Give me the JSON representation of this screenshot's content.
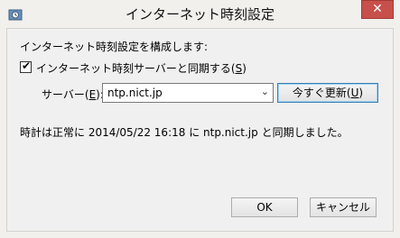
{
  "window": {
    "title": "インターネット時刻設定",
    "close_glyph": "✕"
  },
  "main": {
    "heading": "インターネット時刻設定を構成します:",
    "sync_checkbox": {
      "checked": true,
      "label_prefix": "インターネット時刻サーバーと同期する(",
      "label_mnemonic": "S",
      "label_suffix": ")"
    },
    "server": {
      "label_prefix": "サーバー(",
      "label_mnemonic": "E",
      "label_suffix": "):",
      "value": "ntp.nict.jp"
    },
    "update_button": {
      "label_prefix": "今すぐ更新(",
      "label_mnemonic": "U",
      "label_suffix": ")"
    },
    "status_text": "時計は正常に 2014/05/22 16:18 に ntp.nict.jp と同期しました。"
  },
  "footer": {
    "ok_label": "OK",
    "cancel_label": "キャンセル"
  },
  "icons": {
    "app": "clock-globe-icon",
    "checkmark": "check-icon",
    "dropdown": "chevron-down-icon"
  },
  "colors": {
    "close_button": "#c7504b",
    "focus_border": "#3c7fb1"
  }
}
